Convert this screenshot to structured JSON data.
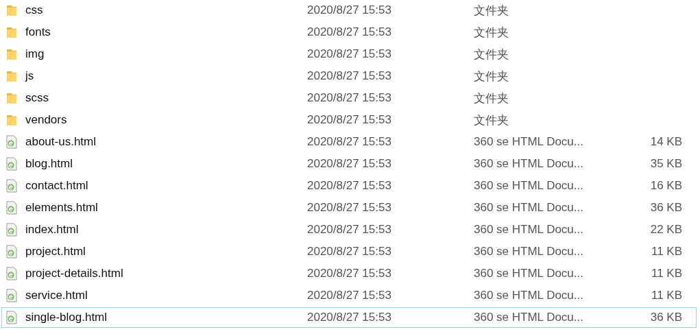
{
  "files": [
    {
      "kind": "folder",
      "name": "css",
      "date": "2020/8/27 15:53",
      "type": "文件夹",
      "focused": false
    },
    {
      "kind": "folder",
      "name": "fonts",
      "date": "2020/8/27 15:53",
      "type": "文件夹",
      "focused": false
    },
    {
      "kind": "folder",
      "name": "img",
      "date": "2020/8/27 15:53",
      "type": "文件夹",
      "focused": false
    },
    {
      "kind": "folder",
      "name": "js",
      "date": "2020/8/27 15:53",
      "type": "文件夹",
      "focused": false
    },
    {
      "kind": "folder",
      "name": "scss",
      "date": "2020/8/27 15:53",
      "type": "文件夹",
      "focused": false
    },
    {
      "kind": "folder",
      "name": "vendors",
      "date": "2020/8/27 15:53",
      "type": "文件夹",
      "focused": false
    },
    {
      "kind": "html",
      "name": "about-us.html",
      "date": "2020/8/27 15:53",
      "type": "360 se HTML Docu...",
      "size": "14 KB",
      "focused": false
    },
    {
      "kind": "html",
      "name": "blog.html",
      "date": "2020/8/27 15:53",
      "type": "360 se HTML Docu...",
      "size": "35 KB",
      "focused": false
    },
    {
      "kind": "html",
      "name": "contact.html",
      "date": "2020/8/27 15:53",
      "type": "360 se HTML Docu...",
      "size": "16 KB",
      "focused": false
    },
    {
      "kind": "html",
      "name": "elements.html",
      "date": "2020/8/27 15:53",
      "type": "360 se HTML Docu...",
      "size": "36 KB",
      "focused": false
    },
    {
      "kind": "html",
      "name": "index.html",
      "date": "2020/8/27 15:53",
      "type": "360 se HTML Docu...",
      "size": "22 KB",
      "focused": false
    },
    {
      "kind": "html",
      "name": "project.html",
      "date": "2020/8/27 15:53",
      "type": "360 se HTML Docu...",
      "size": "11 KB",
      "focused": false
    },
    {
      "kind": "html",
      "name": "project-details.html",
      "date": "2020/8/27 15:53",
      "type": "360 se HTML Docu...",
      "size": "11 KB",
      "focused": false
    },
    {
      "kind": "html",
      "name": "service.html",
      "date": "2020/8/27 15:53",
      "type": "360 se HTML Docu...",
      "size": "11 KB",
      "focused": false
    },
    {
      "kind": "html",
      "name": "single-blog.html",
      "date": "2020/8/27 15:53",
      "type": "360 se HTML Docu...",
      "size": "36 KB",
      "focused": true
    }
  ]
}
